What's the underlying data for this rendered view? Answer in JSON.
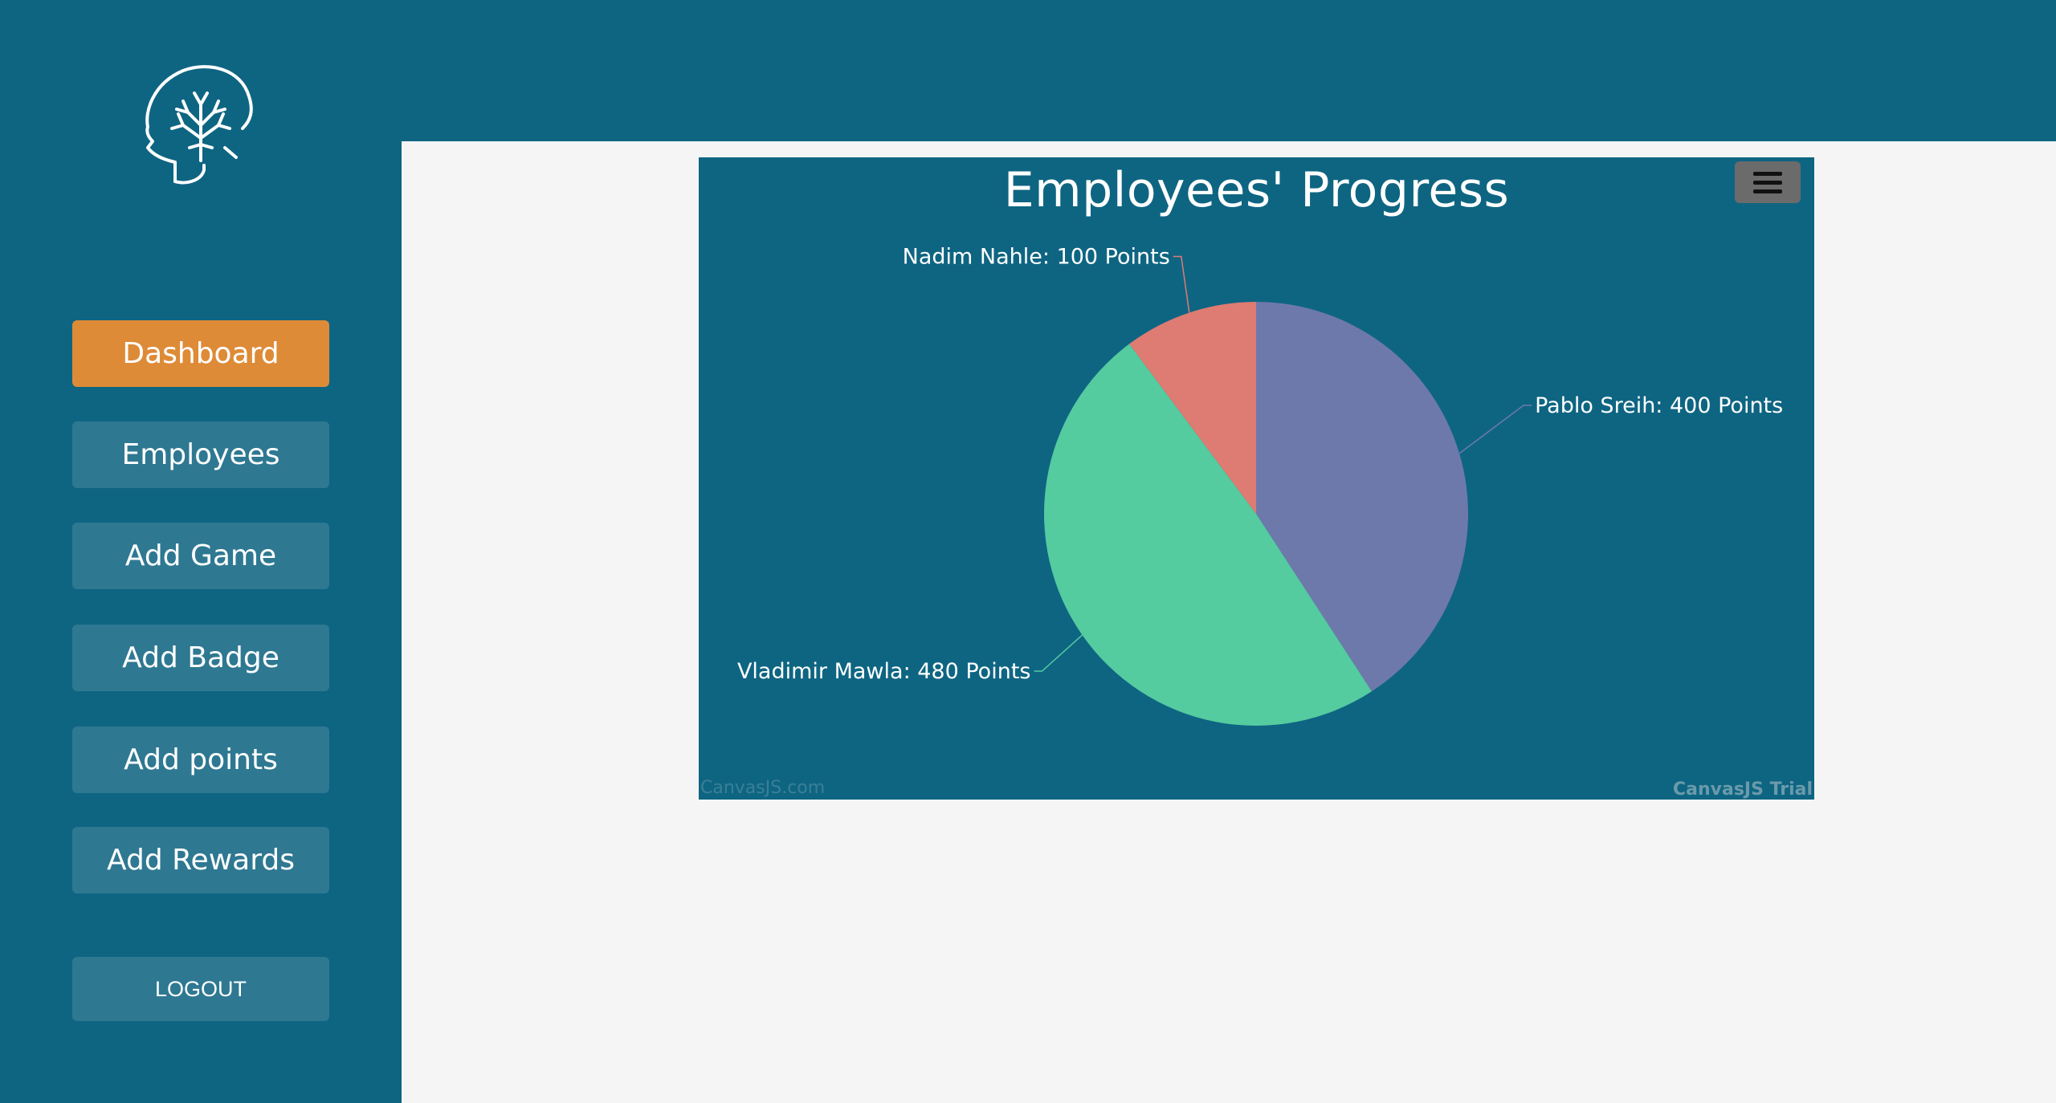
{
  "sidebar": {
    "logo_icon": "brain-head-icon",
    "items": [
      {
        "label": "Dashboard",
        "active": true
      },
      {
        "label": "Employees",
        "active": false
      },
      {
        "label": "Add Game",
        "active": false
      },
      {
        "label": "Add Badge",
        "active": false
      },
      {
        "label": "Add points",
        "active": false
      },
      {
        "label": "Add Rewards",
        "active": false
      }
    ],
    "logout_label": "LOGOUT"
  },
  "colors": {
    "sidebar_bg": "#0e6582",
    "active_button": "#de8b37",
    "button_bg": "#2e7892",
    "content_bg": "#f5f5f5"
  },
  "chart_data": {
    "type": "pie",
    "title": "Employees' Progress",
    "slices": [
      {
        "name": "Pablo Sreih",
        "value": 400,
        "label": "Pablo Sreih: 400 Points",
        "color": "#6e79ab"
      },
      {
        "name": "Vladimir Mawla",
        "value": 480,
        "label": "Vladimir Mawla: 480 Points",
        "color": "#55cba0"
      },
      {
        "name": "Nadim Nahle",
        "value": 100,
        "label": "Nadim Nahle: 100 Points",
        "color": "#de7b72"
      }
    ],
    "menu_icon": "hamburger-icon",
    "watermark_left": "CanvasJS.com",
    "watermark_right": "CanvasJS Trial"
  }
}
